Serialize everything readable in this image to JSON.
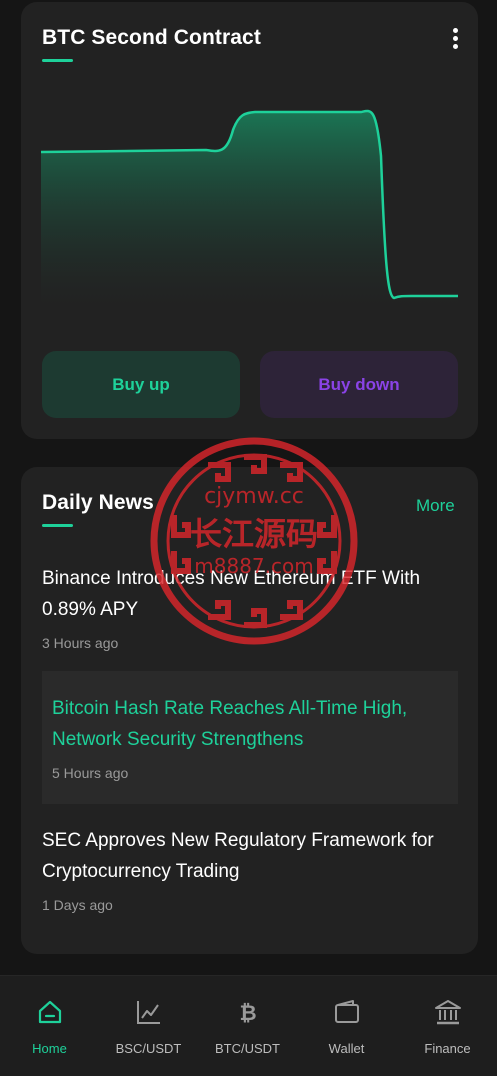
{
  "contract_card": {
    "title": "BTC Second Contract",
    "menu_icon": "more-vertical-icon",
    "buy_up_label": "Buy up",
    "buy_down_label": "Buy down",
    "colors": {
      "up": "#1ed19a",
      "down": "#8a43e6"
    }
  },
  "news": {
    "title": "Daily News",
    "more_label": "More",
    "items": [
      {
        "headline": "Binance Introduces New Ethereum ETF With 0.89% APY",
        "time": "3 Hours ago",
        "highlighted": false
      },
      {
        "headline": "Bitcoin Hash Rate Reaches All-Time High, Network Security Strengthens",
        "time": "5 Hours ago",
        "highlighted": true
      },
      {
        "headline": "SEC Approves New Regulatory Framework for Cryptocurrency Trading",
        "time": "1 Days ago",
        "highlighted": false
      }
    ]
  },
  "tab_bar": {
    "active": "Home",
    "tabs": [
      {
        "label": "Home",
        "icon": "home-icon"
      },
      {
        "label": "BSC/USDT",
        "icon": "line-chart-icon"
      },
      {
        "label": "BTC/USDT",
        "icon": "bitcoin-icon"
      },
      {
        "label": "Wallet",
        "icon": "wallet-icon"
      },
      {
        "label": "Finance",
        "icon": "bank-icon"
      }
    ]
  },
  "watermark": {
    "lines": [
      "cjymw.cc",
      "长江源码",
      "m8887.com"
    ]
  }
}
